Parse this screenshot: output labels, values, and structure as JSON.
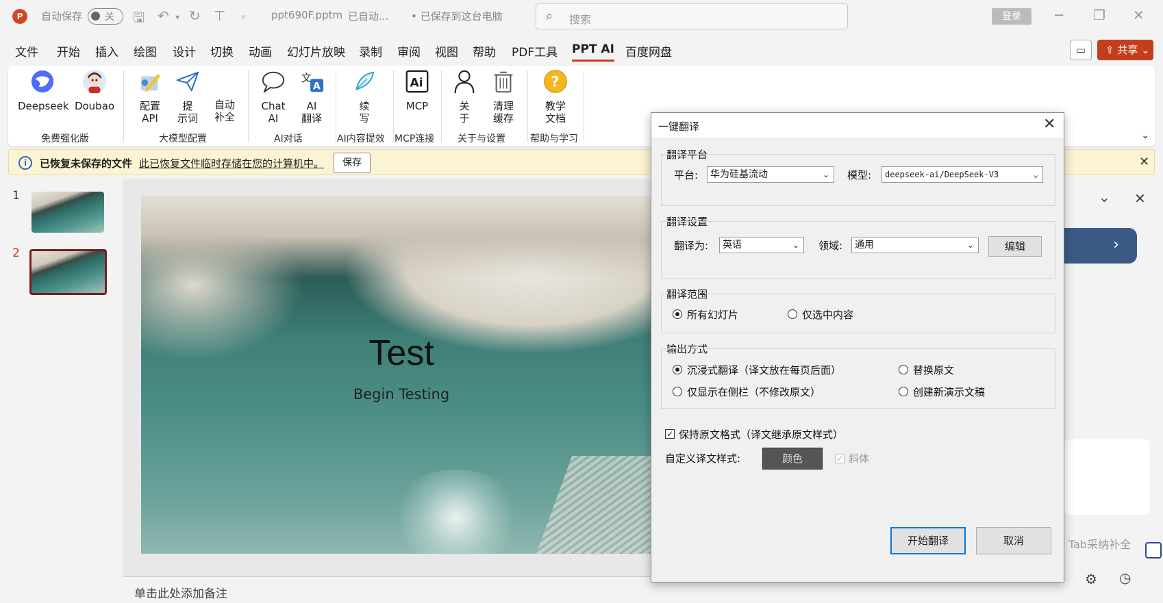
{
  "titlebar": {
    "autosave_label": "自动保存",
    "autosave_state": "关",
    "filename": "ppt690F.pptm",
    "status1": "已自动...",
    "status2": "• 已保存到这台电脑",
    "search_placeholder": "搜索",
    "login_label": "登录"
  },
  "menu": {
    "items": [
      "文件",
      "开始",
      "插入",
      "绘图",
      "设计",
      "切换",
      "动画",
      "幻灯片放映",
      "录制",
      "审阅",
      "视图",
      "帮助",
      "PDF工具",
      "PPT AI",
      "百度网盘"
    ],
    "active": "PPT AI",
    "share_label": "共享"
  },
  "ribbon": {
    "buttons": {
      "deepseek": "Deepseek",
      "doubao": "Doubao",
      "config_api": [
        "配置",
        "API"
      ],
      "prompt": [
        "提",
        "示词"
      ],
      "autocomplete": [
        "自动",
        "补全"
      ],
      "chat_ai": [
        "Chat",
        "AI"
      ],
      "ai_translate": [
        "AI",
        "翻译"
      ],
      "continue": [
        "续",
        "写"
      ],
      "mcp": "MCP",
      "about": [
        "关",
        "于"
      ],
      "clear_cache": [
        "清理",
        "缓存"
      ],
      "docs": [
        "教学",
        "文档"
      ]
    },
    "groups": [
      "免费强化版",
      "大模型配置",
      "AI对话",
      "AI内容提效",
      "MCP连接",
      "关于与设置",
      "帮助与学习"
    ]
  },
  "infobar": {
    "title": "已恢复未保存的文件",
    "message": "此已恢复文件临时存储在您的计算机中。",
    "save_label": "保存"
  },
  "slides": {
    "numbers": [
      "1",
      "2"
    ],
    "selected": 2
  },
  "slide": {
    "title": "Test",
    "subtitle": "Begin Testing"
  },
  "notes_placeholder": "单击此处添加备注",
  "side_pane": {
    "hint": "Tab采纳补全"
  },
  "dialog": {
    "title": "一键翻译",
    "platform_section": "翻译平台",
    "platform_label": "平台:",
    "platform_value": "华为硅基流动",
    "model_label": "模型:",
    "model_value": "deepseek-ai/DeepSeek-V3",
    "settings_section": "翻译设置",
    "target_label": "翻译为:",
    "target_value": "英语",
    "domain_label": "领域:",
    "domain_value": "通用",
    "edit_label": "编辑",
    "scope_section": "翻译范围",
    "scope_all": "所有幻灯片",
    "scope_selected": "仅选中内容",
    "output_section": "输出方式",
    "output_immersive": "沉浸式翻译（译文放在每页后面）",
    "output_replace": "替换原文",
    "output_sidebar": "仅显示在侧栏（不修改原文）",
    "output_new": "创建新演示文稿",
    "keep_format": "保持原文格式（译文继承原文样式）",
    "custom_style_label": "自定义译文样式:",
    "color_label": "颜色",
    "italic_label": "斜体",
    "start_label": "开始翻译",
    "cancel_label": "取消"
  },
  "colors": {
    "accent": "#c43e1c",
    "info_bg": "#fcf3d2",
    "selected_thumb": "#7b1c1c",
    "primary_btn_border": "#0078d7"
  }
}
